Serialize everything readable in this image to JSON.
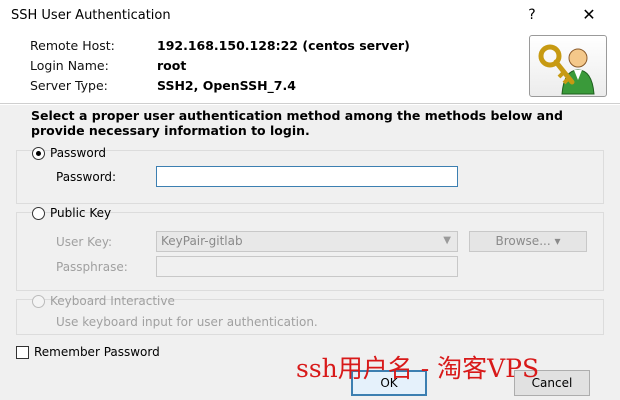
{
  "window": {
    "title": "SSH User Authentication",
    "help_icon": "?",
    "close_icon": "✕"
  },
  "connection": {
    "remote_host_label": "Remote Host:",
    "remote_host_value": "192.168.150.128:22 (centos server)",
    "login_name_label": "Login Name:",
    "login_name_value": "root",
    "server_type_label": "Server Type:",
    "server_type_value": "SSH2, OpenSSH_7.4"
  },
  "instructions": "Select a proper user authentication method among the methods below and provide necessary information to login.",
  "methods": {
    "password": {
      "radio_label": "Password",
      "selected": true,
      "field_label": "Password:",
      "value": ""
    },
    "public_key": {
      "radio_label": "Public Key",
      "selected": false,
      "user_key_label": "User Key:",
      "user_key_value": "KeyPair-gitlab",
      "browse_label": "Browse...",
      "passphrase_label": "Passphrase:",
      "passphrase_value": ""
    },
    "keyboard_interactive": {
      "radio_label": "Keyboard Interactive",
      "selected": false,
      "description": "Use keyboard input for user authentication."
    }
  },
  "remember_password": {
    "label": "Remember Password",
    "checked": false
  },
  "buttons": {
    "ok": "OK",
    "cancel": "Cancel"
  },
  "watermark": "ssh用户名 - 淘客VPS",
  "icons": {
    "key": "key-user-icon",
    "dropdown": "chevron-down-icon"
  },
  "colors": {
    "focus_border": "#3c7fb1",
    "watermark": "#d81919",
    "background": "#f0f0f0"
  }
}
